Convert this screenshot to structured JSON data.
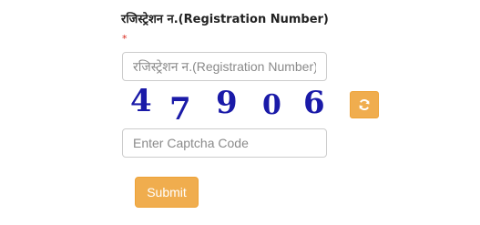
{
  "registration": {
    "label": "रजिस्ट्रेशन न.(Registration Number)",
    "required_marker": "*",
    "placeholder": "रजिस्ट्रेशन न.(Registration Number)",
    "value": ""
  },
  "captcha": {
    "digits": [
      "4",
      "7",
      "9",
      "0",
      "6"
    ],
    "digit_color": "#1a1aa8",
    "refresh_icon": "refresh-icon",
    "input_placeholder": "Enter Captcha Code",
    "input_value": ""
  },
  "submit": {
    "label": "Submit"
  },
  "colors": {
    "button_bg": "#f0ad4e",
    "button_border": "#eea236",
    "required": "#d9291c"
  }
}
